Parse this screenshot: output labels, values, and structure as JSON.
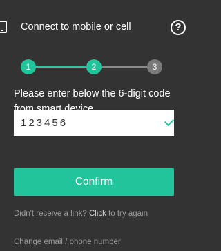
{
  "header": {
    "title": "Connect to mobile or cell",
    "help_label": "?"
  },
  "stepper": {
    "steps": [
      "1",
      "2",
      "3"
    ],
    "current": 2
  },
  "instructions": "Please enter below the 6-digit code from smart device.",
  "code_field": {
    "value": "123456"
  },
  "confirm_label": "Confirm",
  "resend": {
    "prefix": "Didn't receive a link? ",
    "link": "Click",
    "suffix": " to try again"
  },
  "change_link": "Change email / phone number",
  "colors": {
    "background": "#333333",
    "accent": "#22c49b",
    "inactive_step": "#7a7a7a"
  }
}
